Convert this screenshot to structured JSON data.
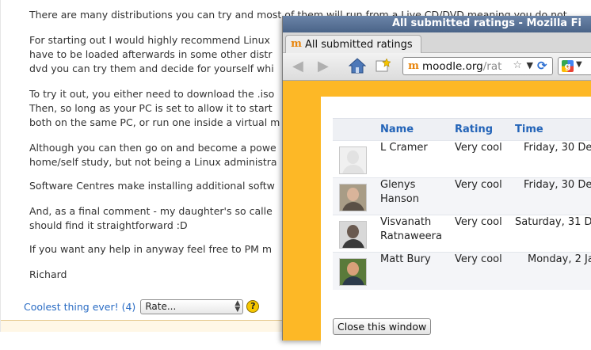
{
  "post": {
    "paragraphs": [
      [
        "There are many distributions you can try and most of them will run from a Live CD/DVD meaning you do not"
      ],
      [
        "For starting out I would highly recommend Linux",
        "have to be loaded afterwards in some other distr",
        "dvd you can try them and decide for yourself whi"
      ],
      [
        "To try it out, you either need to download the .iso",
        "Then, so long as your PC is set to allow it to start",
        "both on the same PC, or run one inside a virtual m"
      ],
      [
        "Although you can then go on and become a powe",
        "home/self study, but not being a Linux administra"
      ],
      [
        "Software Centres make installing additional softw"
      ],
      [
        "And, as a final comment - my daughter's so calle",
        "should find it straightforward :D"
      ],
      [
        "If you want any help in anyway feel free to PM m"
      ],
      [
        "Richard"
      ]
    ],
    "rating_link": "Coolest thing ever! (4)",
    "rate_select_value": "Rate...",
    "help_icon": "?"
  },
  "window": {
    "title": "All submitted ratings - Mozilla Fi",
    "tab_label": "All submitted ratings",
    "url_host": "moodle.org",
    "url_path": "/rat"
  },
  "ratings": {
    "columns": [
      "Name",
      "Rating",
      "Time"
    ],
    "rows": [
      {
        "name": "L Cramer",
        "rating": "Very cool",
        "time": "Friday, 30 De"
      },
      {
        "name": "Glenys Hanson",
        "rating": "Very cool",
        "time": "Friday, 30 De"
      },
      {
        "name": "Visvanath Ratnaweera",
        "rating": "Very cool",
        "time": "Saturday, 31 D"
      },
      {
        "name": "Matt Bury",
        "rating": "Very cool",
        "time": "Monday, 2 Ja"
      }
    ],
    "close_label": "Close this window"
  },
  "colors": {
    "link": "#2a6cc4",
    "popup_bg": "#fdb826",
    "table_header": "#2364b8"
  }
}
